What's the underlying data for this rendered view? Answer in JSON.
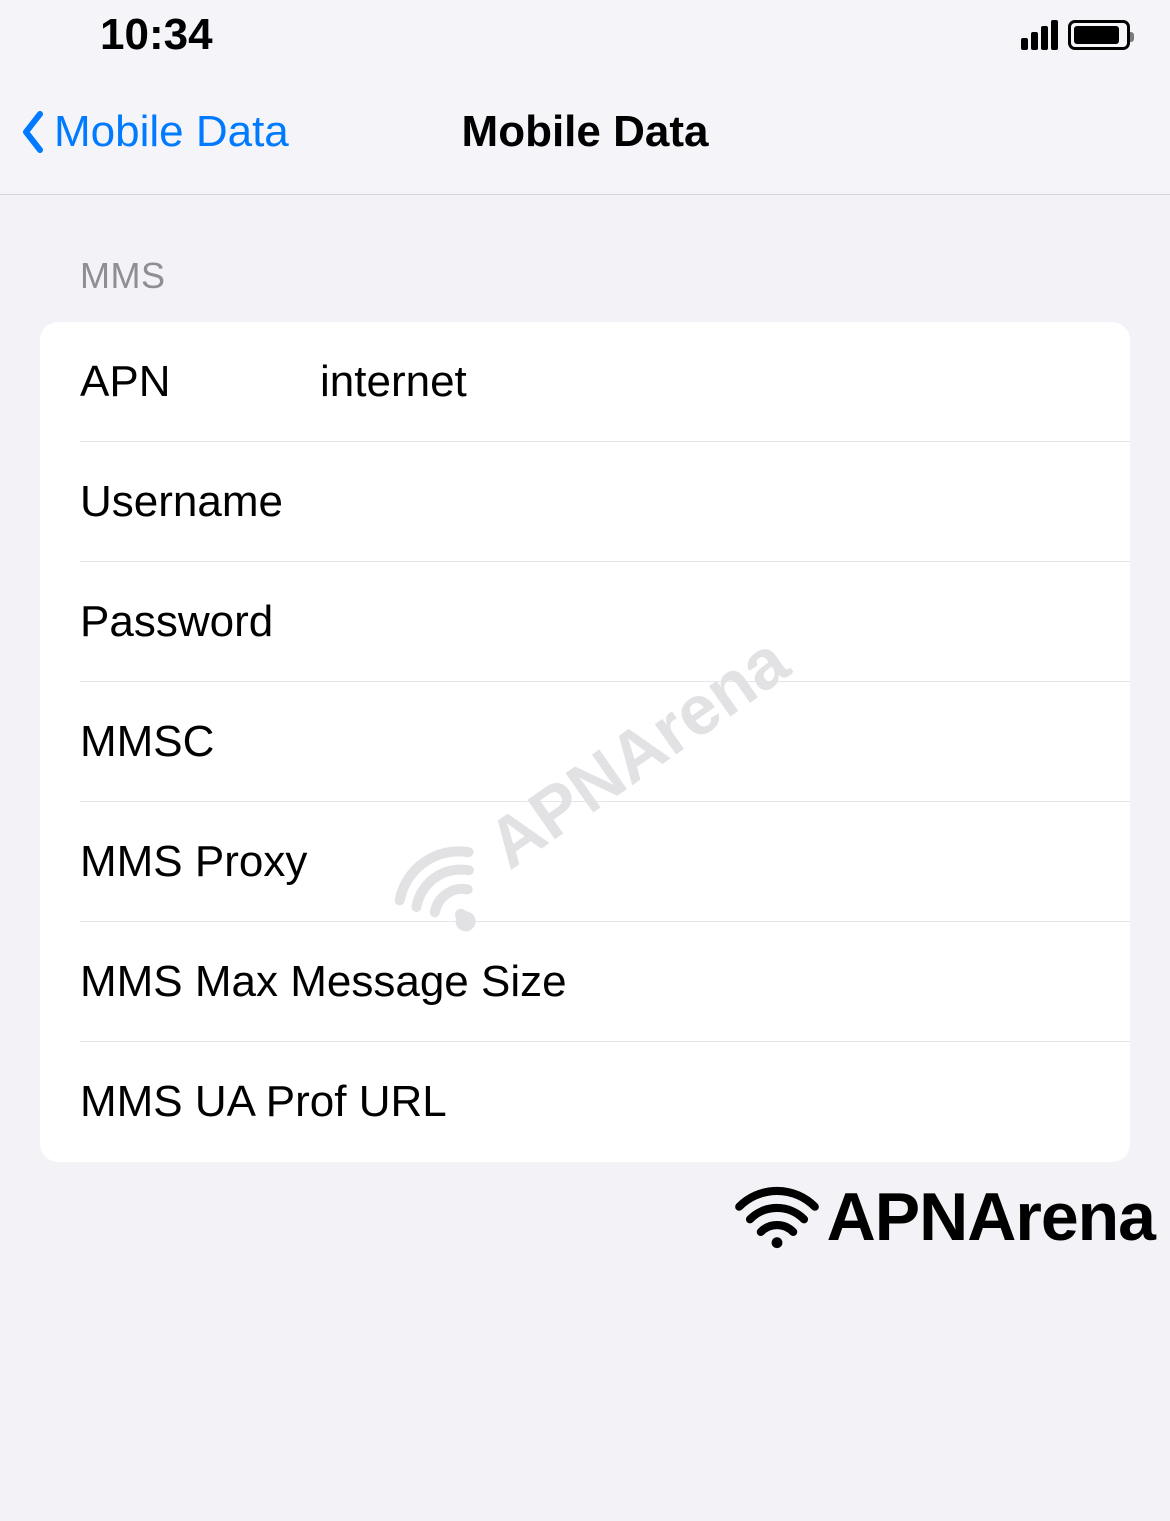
{
  "statusBar": {
    "time": "10:34"
  },
  "navBar": {
    "backLabel": "Mobile Data",
    "title": "Mobile Data"
  },
  "section": {
    "header": "MMS",
    "rows": {
      "apn": {
        "label": "APN",
        "value": "internet"
      },
      "username": {
        "label": "Username",
        "value": ""
      },
      "password": {
        "label": "Password",
        "value": ""
      },
      "mmsc": {
        "label": "MMSC",
        "value": ""
      },
      "mmsProxy": {
        "label": "MMS Proxy",
        "value": ""
      },
      "mmsMaxMessageSize": {
        "label": "MMS Max Message Size",
        "value": ""
      },
      "mmsUAProfURL": {
        "label": "MMS UA Prof URL",
        "value": ""
      }
    }
  },
  "watermark": "APNArena",
  "footerLogo": "APNArena"
}
